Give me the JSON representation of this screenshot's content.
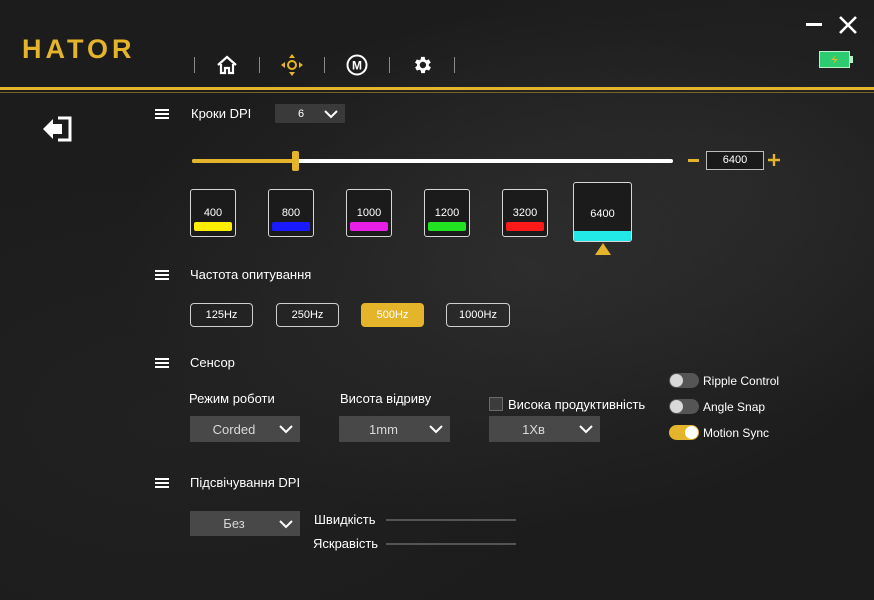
{
  "app": {
    "logo": "HATOR"
  },
  "nav": {
    "icons": [
      "home-icon",
      "move-icon",
      "macro-icon",
      "gear-icon"
    ],
    "macro_letter": "M"
  },
  "colors": {
    "accent": "#e4b52a",
    "battery": "#2ecc71"
  },
  "dpi": {
    "title": "Кроки DPI",
    "steps_value": "6",
    "value": "6400",
    "slider_fraction": 0.22,
    "levels": [
      {
        "value": "400",
        "color": "#ffee00"
      },
      {
        "value": "800",
        "color": "#1a1aff"
      },
      {
        "value": "1000",
        "color": "#e61ee6"
      },
      {
        "value": "1200",
        "color": "#22e322"
      },
      {
        "value": "3200",
        "color": "#ff1a1a"
      },
      {
        "value": "6400",
        "color": "#22e8e8"
      }
    ],
    "active_index": 5
  },
  "polling": {
    "title": "Частота опитування",
    "options": [
      "125Hz",
      "250Hz",
      "500Hz",
      "1000Hz"
    ],
    "active_index": 2
  },
  "sensor": {
    "title": "Сенсор",
    "mode_label": "Режим роботи",
    "mode_value": "Corded",
    "lod_label": "Висота відриву",
    "lod_value": "1mm",
    "high_perf_label": "Висока продуктивність",
    "high_perf_checked": false,
    "high_perf_value": "1Хв",
    "toggles": [
      {
        "label": "Ripple Control",
        "on": false
      },
      {
        "label": "Angle Snap",
        "on": false
      },
      {
        "label": "Motion Sync",
        "on": true
      }
    ]
  },
  "lighting": {
    "title": "Підсвічування DPI",
    "mode_value": "Без",
    "speed_label": "Швидкість",
    "brightness_label": "Яскравість"
  }
}
